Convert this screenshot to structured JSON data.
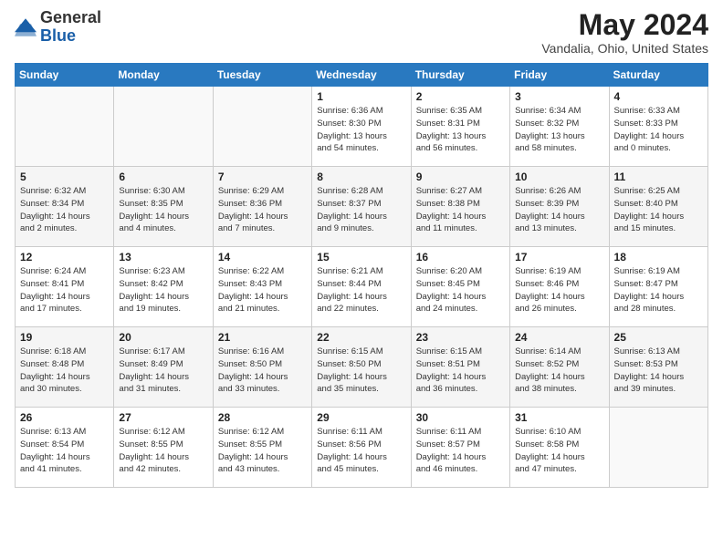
{
  "logo": {
    "general": "General",
    "blue": "Blue"
  },
  "header": {
    "month": "May 2024",
    "location": "Vandalia, Ohio, United States"
  },
  "weekdays": [
    "Sunday",
    "Monday",
    "Tuesday",
    "Wednesday",
    "Thursday",
    "Friday",
    "Saturday"
  ],
  "weeks": [
    [
      {
        "day": "",
        "info": ""
      },
      {
        "day": "",
        "info": ""
      },
      {
        "day": "",
        "info": ""
      },
      {
        "day": "1",
        "info": "Sunrise: 6:36 AM\nSunset: 8:30 PM\nDaylight: 13 hours\nand 54 minutes."
      },
      {
        "day": "2",
        "info": "Sunrise: 6:35 AM\nSunset: 8:31 PM\nDaylight: 13 hours\nand 56 minutes."
      },
      {
        "day": "3",
        "info": "Sunrise: 6:34 AM\nSunset: 8:32 PM\nDaylight: 13 hours\nand 58 minutes."
      },
      {
        "day": "4",
        "info": "Sunrise: 6:33 AM\nSunset: 8:33 PM\nDaylight: 14 hours\nand 0 minutes."
      }
    ],
    [
      {
        "day": "5",
        "info": "Sunrise: 6:32 AM\nSunset: 8:34 PM\nDaylight: 14 hours\nand 2 minutes."
      },
      {
        "day": "6",
        "info": "Sunrise: 6:30 AM\nSunset: 8:35 PM\nDaylight: 14 hours\nand 4 minutes."
      },
      {
        "day": "7",
        "info": "Sunrise: 6:29 AM\nSunset: 8:36 PM\nDaylight: 14 hours\nand 7 minutes."
      },
      {
        "day": "8",
        "info": "Sunrise: 6:28 AM\nSunset: 8:37 PM\nDaylight: 14 hours\nand 9 minutes."
      },
      {
        "day": "9",
        "info": "Sunrise: 6:27 AM\nSunset: 8:38 PM\nDaylight: 14 hours\nand 11 minutes."
      },
      {
        "day": "10",
        "info": "Sunrise: 6:26 AM\nSunset: 8:39 PM\nDaylight: 14 hours\nand 13 minutes."
      },
      {
        "day": "11",
        "info": "Sunrise: 6:25 AM\nSunset: 8:40 PM\nDaylight: 14 hours\nand 15 minutes."
      }
    ],
    [
      {
        "day": "12",
        "info": "Sunrise: 6:24 AM\nSunset: 8:41 PM\nDaylight: 14 hours\nand 17 minutes."
      },
      {
        "day": "13",
        "info": "Sunrise: 6:23 AM\nSunset: 8:42 PM\nDaylight: 14 hours\nand 19 minutes."
      },
      {
        "day": "14",
        "info": "Sunrise: 6:22 AM\nSunset: 8:43 PM\nDaylight: 14 hours\nand 21 minutes."
      },
      {
        "day": "15",
        "info": "Sunrise: 6:21 AM\nSunset: 8:44 PM\nDaylight: 14 hours\nand 22 minutes."
      },
      {
        "day": "16",
        "info": "Sunrise: 6:20 AM\nSunset: 8:45 PM\nDaylight: 14 hours\nand 24 minutes."
      },
      {
        "day": "17",
        "info": "Sunrise: 6:19 AM\nSunset: 8:46 PM\nDaylight: 14 hours\nand 26 minutes."
      },
      {
        "day": "18",
        "info": "Sunrise: 6:19 AM\nSunset: 8:47 PM\nDaylight: 14 hours\nand 28 minutes."
      }
    ],
    [
      {
        "day": "19",
        "info": "Sunrise: 6:18 AM\nSunset: 8:48 PM\nDaylight: 14 hours\nand 30 minutes."
      },
      {
        "day": "20",
        "info": "Sunrise: 6:17 AM\nSunset: 8:49 PM\nDaylight: 14 hours\nand 31 minutes."
      },
      {
        "day": "21",
        "info": "Sunrise: 6:16 AM\nSunset: 8:50 PM\nDaylight: 14 hours\nand 33 minutes."
      },
      {
        "day": "22",
        "info": "Sunrise: 6:15 AM\nSunset: 8:50 PM\nDaylight: 14 hours\nand 35 minutes."
      },
      {
        "day": "23",
        "info": "Sunrise: 6:15 AM\nSunset: 8:51 PM\nDaylight: 14 hours\nand 36 minutes."
      },
      {
        "day": "24",
        "info": "Sunrise: 6:14 AM\nSunset: 8:52 PM\nDaylight: 14 hours\nand 38 minutes."
      },
      {
        "day": "25",
        "info": "Sunrise: 6:13 AM\nSunset: 8:53 PM\nDaylight: 14 hours\nand 39 minutes."
      }
    ],
    [
      {
        "day": "26",
        "info": "Sunrise: 6:13 AM\nSunset: 8:54 PM\nDaylight: 14 hours\nand 41 minutes."
      },
      {
        "day": "27",
        "info": "Sunrise: 6:12 AM\nSunset: 8:55 PM\nDaylight: 14 hours\nand 42 minutes."
      },
      {
        "day": "28",
        "info": "Sunrise: 6:12 AM\nSunset: 8:55 PM\nDaylight: 14 hours\nand 43 minutes."
      },
      {
        "day": "29",
        "info": "Sunrise: 6:11 AM\nSunset: 8:56 PM\nDaylight: 14 hours\nand 45 minutes."
      },
      {
        "day": "30",
        "info": "Sunrise: 6:11 AM\nSunset: 8:57 PM\nDaylight: 14 hours\nand 46 minutes."
      },
      {
        "day": "31",
        "info": "Sunrise: 6:10 AM\nSunset: 8:58 PM\nDaylight: 14 hours\nand 47 minutes."
      },
      {
        "day": "",
        "info": ""
      }
    ]
  ]
}
